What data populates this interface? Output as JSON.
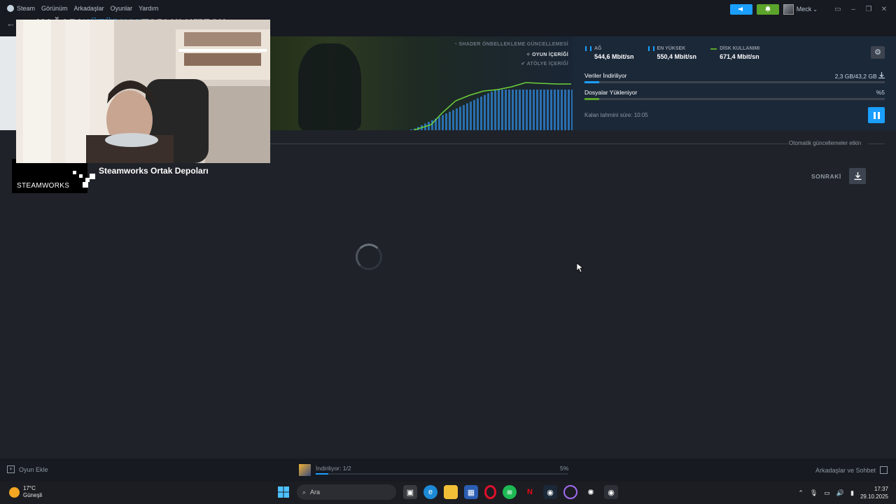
{
  "menu": {
    "items": [
      "Steam",
      "Görünüm",
      "Arkadaşlar",
      "Oyunlar",
      "Yardım"
    ]
  },
  "top_right": {
    "user_name": "Meck",
    "announce_icon": "megaphone-icon",
    "notify_icon": "bell-icon"
  },
  "nav": {
    "tabs": [
      "MAĞAZA",
      "KÜTÜPHANE",
      "TOPLULUK",
      "MECK"
    ],
    "active_tab": "KÜTÜPHANE"
  },
  "download_header": {
    "content_types": [
      {
        "label": "SHADER ÖNBELLEKLEME GÜNCELLEMESİ",
        "state": "dim"
      },
      {
        "label": "OYUN İÇERİĞİ",
        "state": "active"
      },
      {
        "label": "ATÖLYE İÇERİĞİ",
        "state": "dim"
      }
    ],
    "stats": [
      {
        "label": "AĞ",
        "value": "544,6 Mbit/sn",
        "color": "#1a9fff"
      },
      {
        "label": "EN YÜKSEK",
        "value": "550,4 Mbit/sn",
        "color": "#1a9fff"
      },
      {
        "label": "DİSK KULLANIMI",
        "value": "671,4 Mbit/sn",
        "color": "#5ba32b"
      }
    ],
    "progress": [
      {
        "label": "Veriler İndiriliyor",
        "right": "2,3 GB/43,2 GB",
        "fraction": 0.05,
        "color": "#1a9fff"
      },
      {
        "label": "Dosyalar Yükleniyor",
        "right": "%5",
        "fraction": 0.05,
        "color": "#5ba32b"
      }
    ],
    "remaining": "Kalan tahmini süre: 10:05"
  },
  "section": {
    "auto_updates": "Otomatik güncellemeler etkin",
    "app_logo_text": "STEAMWORKS",
    "app_name": "Steamworks Ortak Depoları",
    "next_label": "SONRAKİ"
  },
  "bottom_bar": {
    "add_game": "Oyun Ekle",
    "downloading": "İndiriliyor: 1/2",
    "percent": "5%",
    "progress_fraction": 0.05,
    "friends": "Arkadaşlar ve Sohbet"
  },
  "taskbar": {
    "temperature": "17°C",
    "weather": "Güneşli",
    "search_placeholder": "Ara",
    "time": "17:37",
    "date": "29.10.2025"
  }
}
